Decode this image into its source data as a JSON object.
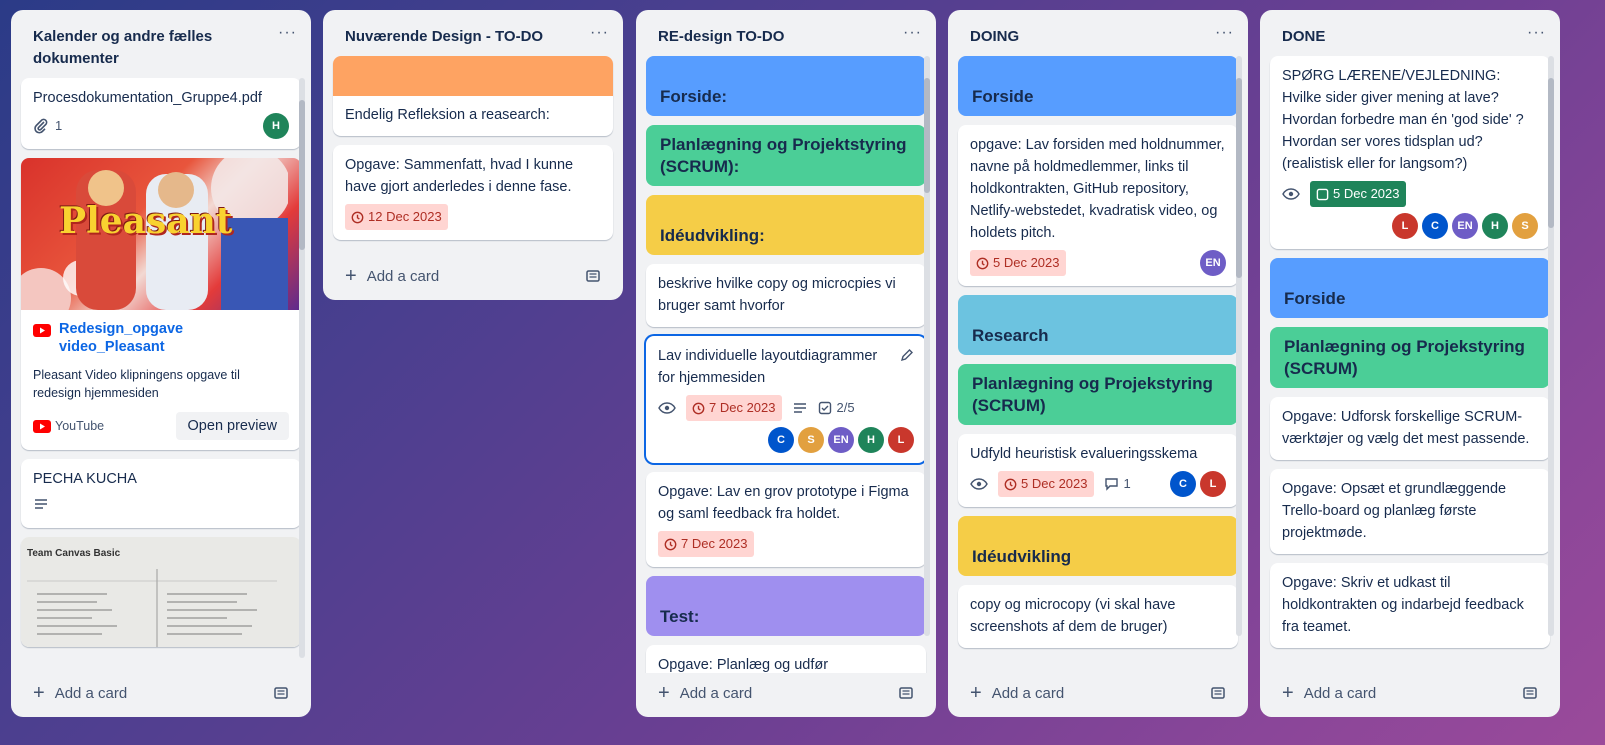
{
  "lists": [
    {
      "title": "Kalender og andre fælles dokumenter",
      "cards": [
        {
          "text": "Procesdokumentation_Gruppe4.pdf",
          "attachments": "1",
          "member": "H"
        },
        {
          "cover_text": "Pleasant",
          "link_title": "Redesign_opgave video_Pleasant",
          "description": "Pleasant Video klipningens opgave til redesign hjemmesiden",
          "source": "YouTube",
          "preview_label": "Open preview"
        },
        {
          "text": "PECHA KUCHA"
        },
        {
          "cover_title": "Team Canvas Basic"
        }
      ]
    },
    {
      "title": "Nuværende Design - TO-DO",
      "cards": [
        {
          "text": "Endelig Refleksion a reasearch:"
        },
        {
          "text": "Opgave: Sammenfatt, hvad I kunne have gjort anderledes i denne fase.",
          "date": "12 Dec 2023"
        }
      ]
    },
    {
      "title": "RE-design TO-DO",
      "cards": [
        {
          "label": "Forside:"
        },
        {
          "label": "Planlægning og Projektstyring (SCRUM):"
        },
        {
          "label": "Idéudvikling:"
        },
        {
          "text": "beskrive hvilke copy og microcpies vi bruger samt hvorfor"
        },
        {
          "text": "Lav individuelle layoutdiagrammer for hjemmesiden",
          "date": "7 Dec 2023",
          "checklist": "2/5",
          "members": [
            "C",
            "S",
            "EN",
            "H",
            "L"
          ]
        },
        {
          "text": "Opgave: Lav en grov prototype i Figma og saml feedback fra holdet.",
          "date": "7 Dec 2023"
        },
        {
          "label": "Test:"
        },
        {
          "text": "Opgave: Planlæg og udfør"
        }
      ]
    },
    {
      "title": "DOING",
      "cards": [
        {
          "label": "Forside"
        },
        {
          "text": "opgave: Lav forsiden med holdnummer, navne på holdmedlemmer, links til holdkontrakten, GitHub repository, Netlify-webstedet, kvadratisk video, og holdets pitch.",
          "date": "5 Dec 2023",
          "member": "EN"
        },
        {
          "label": "Research"
        },
        {
          "label": "Planlægning og Projekstyring (SCRUM)"
        },
        {
          "text": "Udfyld heuristisk evalueringsskema",
          "date": "5 Dec 2023",
          "comments": "1",
          "members": [
            "C",
            "L"
          ]
        },
        {
          "label": "Idéudvikling"
        },
        {
          "text": "copy og microcopy (vi skal have screenshots af dem de bruger)"
        }
      ]
    },
    {
      "title": "DONE",
      "cards": [
        {
          "text": "SPØRG LÆRENE/VEJLEDNING: Hvilke sider giver mening at lave? Hvordan forbedre man én 'god side' ? Hvordan ser vores tidsplan ud? (realistisk eller for langsom?)",
          "date": "5 Dec 2023",
          "members": [
            "L",
            "C",
            "EN",
            "H",
            "S"
          ]
        },
        {
          "label": "Forside"
        },
        {
          "label": "Planlægning og Projekstyring (SCRUM)"
        },
        {
          "text": "Opgave: Udforsk forskellige SCRUM-værktøjer og vælg det mest passende."
        },
        {
          "text": "Opgave: Opsæt et grundlæggende Trello-board og planlæg første projektmøde."
        },
        {
          "text": "Opgave: Skriv et udkast til holdkontrakten og indarbejd feedback fra teamet."
        }
      ]
    }
  ],
  "add_card_label": "Add a card",
  "colors": {
    "blue_label": "#579dff",
    "green_label": "#4bce97",
    "yellow_label": "#f5cd47",
    "purple_label": "#9f8fef",
    "sky_label": "#6cc3e0",
    "orange_cover": "#fea362",
    "avatar_C": "#0055cc",
    "avatar_S": "#e2a03f",
    "avatar_EN": "#6e5dc6",
    "avatar_H": "#1f845a",
    "avatar_L": "#c9372c"
  }
}
